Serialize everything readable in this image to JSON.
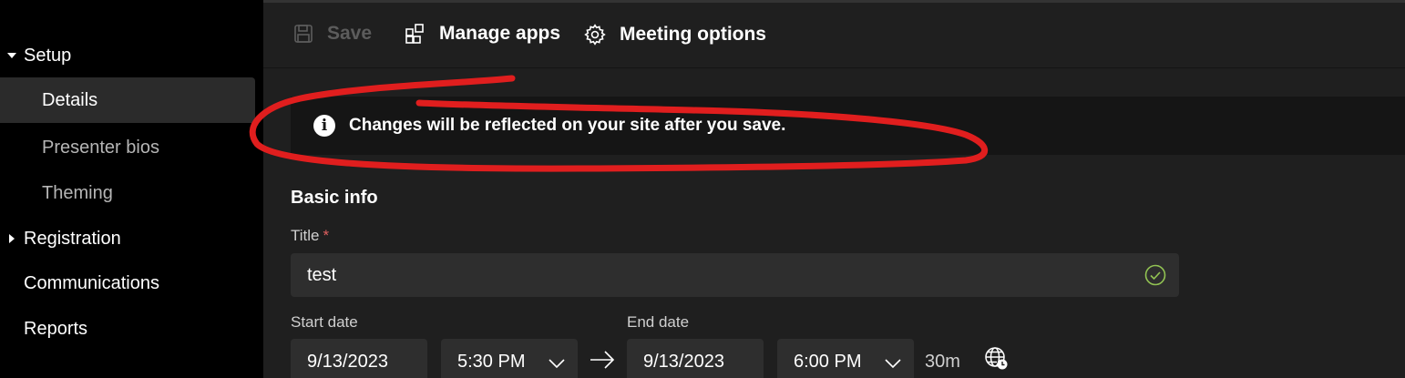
{
  "sidebar": {
    "items": [
      {
        "label": "Setup",
        "expanded": true
      },
      {
        "label": "Details",
        "active": true
      },
      {
        "label": "Presenter bios"
      },
      {
        "label": "Theming"
      },
      {
        "label": "Registration",
        "expanded": false
      },
      {
        "label": "Communications"
      },
      {
        "label": "Reports"
      }
    ]
  },
  "toolbar": {
    "save_label": "Save",
    "save_icon": "save-icon",
    "manage_apps_label": "Manage apps",
    "manage_apps_icon": "apps-icon",
    "meeting_options_label": "Meeting options",
    "meeting_options_icon": "gear-icon"
  },
  "banner": {
    "icon": "info-icon",
    "text": "Changes will be reflected on your site after you save."
  },
  "form": {
    "section_title": "Basic info",
    "title_label": "Title",
    "required_marker": "*",
    "title_value": "test",
    "start_date_label": "Start date",
    "start_date_value": "9/13/2023",
    "start_time_value": "5:30 PM",
    "end_date_label": "End date",
    "end_date_value": "9/13/2023",
    "end_time_value": "6:00 PM",
    "duration": "30m"
  },
  "colors": {
    "annotation_red": "#e01e1e",
    "valid_green": "#92c353"
  }
}
